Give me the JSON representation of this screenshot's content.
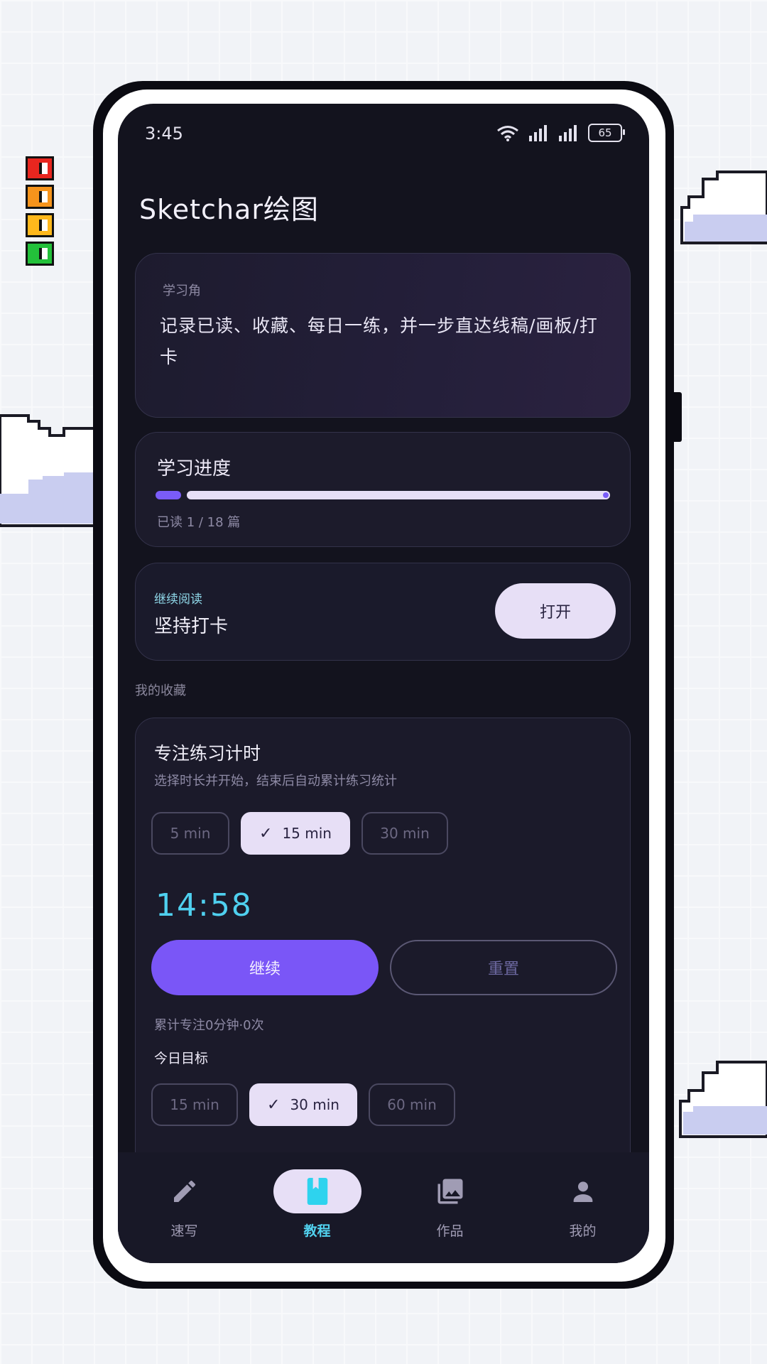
{
  "status_bar": {
    "time": "3:45",
    "battery": "65"
  },
  "app": {
    "title": "Sketchar绘图"
  },
  "hero_card": {
    "kicker": "学习角",
    "text": "记录已读、收藏、每日一练，并一步直达线稿/画板/打卡"
  },
  "progress_card": {
    "title": "学习进度",
    "progress_value": 0.056,
    "text": "已读 1 / 18 篇"
  },
  "continue_card": {
    "kicker": "继续阅读",
    "title": "坚持打卡",
    "open_label": "打开"
  },
  "favorites_label": "我的收藏",
  "timer_card": {
    "title": "专注练习计时",
    "subtitle": "选择时长并开始，结束后自动累计练习统计",
    "durations": [
      "5 min",
      "15 min",
      "30 min"
    ],
    "selected_duration": "15 min",
    "display": "14:58",
    "continue_label": "继续",
    "reset_label": "重置",
    "total_text": "累计专注0分钟·0次",
    "goal_label": "今日目标",
    "goals": [
      "15 min",
      "30 min",
      "60 min"
    ],
    "selected_goal": "30 min"
  },
  "bottom_nav": {
    "items": [
      {
        "label": "速写",
        "icon": "pencil-icon"
      },
      {
        "label": "教程",
        "icon": "book-icon"
      },
      {
        "label": "作品",
        "icon": "gallery-icon"
      },
      {
        "label": "我的",
        "icon": "person-icon"
      }
    ],
    "active": "教程"
  },
  "colors": {
    "accent": "#7a56f7",
    "cyan": "#51d1ee",
    "chip_selected": "#e7dff6",
    "screen_bg": "#13131e"
  }
}
